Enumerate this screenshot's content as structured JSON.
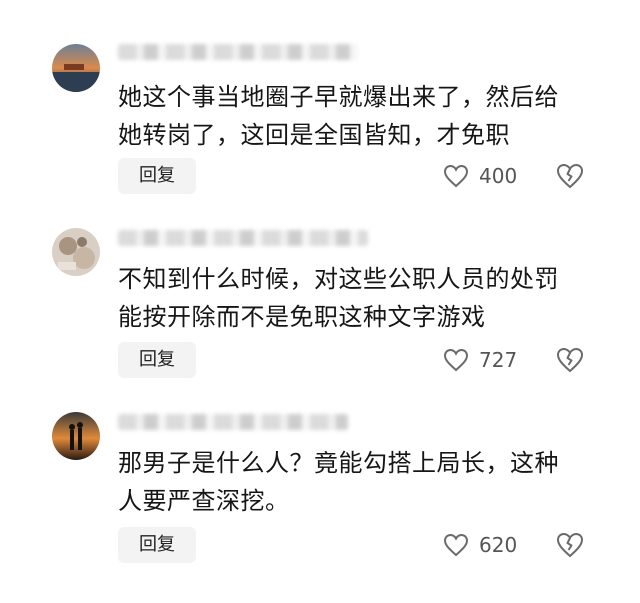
{
  "comments": [
    {
      "text_line1": "她这个事当地圈子早就爆出来了，然后给",
      "text_line2": "她转岗了，这回是全国皆知，才免职",
      "reply_label": "回复",
      "like_count": "400"
    },
    {
      "text_line1": "不知到什么时候，对这些公职人员的处罚",
      "text_line2": "能按开除而不是免职这种文字游戏",
      "reply_label": "回复",
      "like_count": "727"
    },
    {
      "text_line1": "那男子是什么人？竟能勾搭上局长，这种",
      "text_line2": "人要严查深挖。",
      "reply_label": "回复",
      "like_count": "620"
    }
  ],
  "icons": {
    "like": "heart-outline-icon",
    "dislike": "broken-heart-outline-icon"
  },
  "colors": {
    "reply_bg": "#f3f3f3",
    "icon_stroke": "#6b6b6b"
  }
}
